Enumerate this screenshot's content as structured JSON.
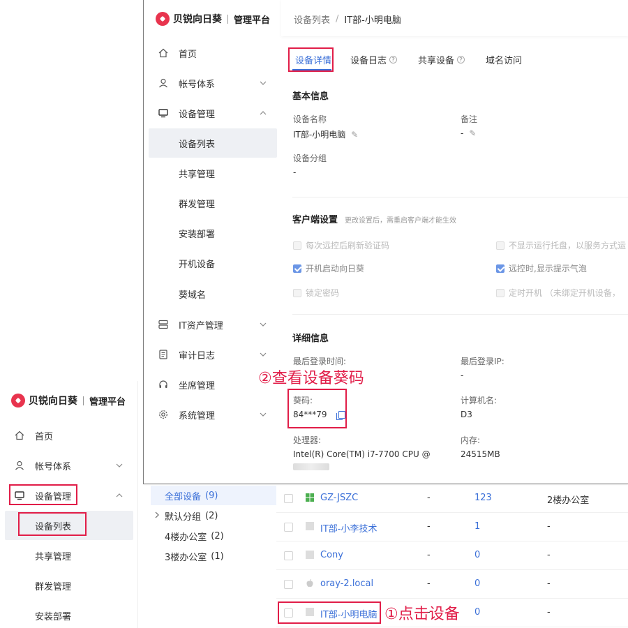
{
  "brand": {
    "name": "贝锐向日葵",
    "subtitle": "管理平台"
  },
  "sidebar": {
    "items": [
      {
        "label": "首页",
        "icon": "home-icon"
      },
      {
        "label": "帐号体系",
        "icon": "user-icon"
      },
      {
        "label": "设备管理",
        "icon": "monitor-icon"
      },
      {
        "label": "IT资产管理",
        "icon": "server-icon"
      },
      {
        "label": "审计日志",
        "icon": "document-icon"
      },
      {
        "label": "坐席管理",
        "icon": "headset-icon"
      },
      {
        "label": "系统管理",
        "icon": "gear-icon"
      }
    ],
    "device_sub": [
      "设备列表",
      "共享管理",
      "群发管理",
      "安装部署",
      "开机设备",
      "葵域名"
    ]
  },
  "breadcrumb": {
    "parent": "设备列表",
    "separator": "/",
    "current": "IT部-小明电脑"
  },
  "tabs": [
    "设备详情",
    "设备日志",
    "共享设备",
    "域名访问"
  ],
  "basic_info": {
    "title": "基本信息",
    "name_label": "设备名称",
    "name_value": "IT部-小明电脑",
    "note_label": "备注",
    "note_value": "-",
    "group_label": "设备分组",
    "group_value": "-"
  },
  "client_settings": {
    "title": "客户端设置",
    "hint": "更改设置后，需重启客户端才能生效",
    "options": [
      {
        "label": "每次远控后刷新验证码",
        "checked": false,
        "enabled": false
      },
      {
        "label": "不显示运行托盘，以服务方式运",
        "checked": false,
        "enabled": false
      },
      {
        "label": "开机启动向日葵",
        "checked": true,
        "enabled": true
      },
      {
        "label": "远控时,显示提示气泡",
        "checked": true,
        "enabled": true
      },
      {
        "label": "锁定密码",
        "checked": false,
        "enabled": false
      },
      {
        "label": "定时开机 （未绑定开机设备，",
        "checked": false,
        "enabled": false
      }
    ]
  },
  "details": {
    "title": "详细信息",
    "last_login_time_label": "最后登录时间:",
    "last_login_ip_label": "最后登录IP:",
    "last_login_ip_value": "-",
    "code_label": "葵码:",
    "code_value": "84***79",
    "hostname_label": "计算机名:",
    "hostname_value": "D3",
    "cpu_label": "处理器:",
    "cpu_value": "Intel(R) Core(TM) i7-7700 CPU @",
    "memory_label": "内存:",
    "memory_value": "24515MB"
  },
  "groups": [
    {
      "label": "全部设备",
      "count": "(9)"
    },
    {
      "label": "默认分组",
      "count": "(2)"
    },
    {
      "label": "4楼办公室",
      "count": "(2)"
    },
    {
      "label": "3楼办公室",
      "count": "(1)"
    }
  ],
  "devices": [
    {
      "name": "GZ-JSZC",
      "col2": "-",
      "col3": "123",
      "col4": "2楼办公室",
      "icon": "windows-icon"
    },
    {
      "name": "IT部-小李技术",
      "col2": "-",
      "col3": "1",
      "col4": "-",
      "icon": "device-icon"
    },
    {
      "name": "Cony",
      "col2": "-",
      "col3": "0",
      "col4": "-",
      "icon": "device-icon"
    },
    {
      "name": "oray-2.local",
      "col2": "-",
      "col3": "0",
      "col4": "-",
      "icon": "apple-icon"
    },
    {
      "name": "IT部-小明电脑",
      "col2": "-",
      "col3": "0",
      "col4": "-",
      "icon": "device-icon"
    }
  ],
  "annotations": {
    "step1": "①点击设备",
    "step2": "②查看设备葵码"
  },
  "colors": {
    "accent": "#3a6fd8",
    "annotation": "#e11d48",
    "brand": "#e8344e"
  }
}
